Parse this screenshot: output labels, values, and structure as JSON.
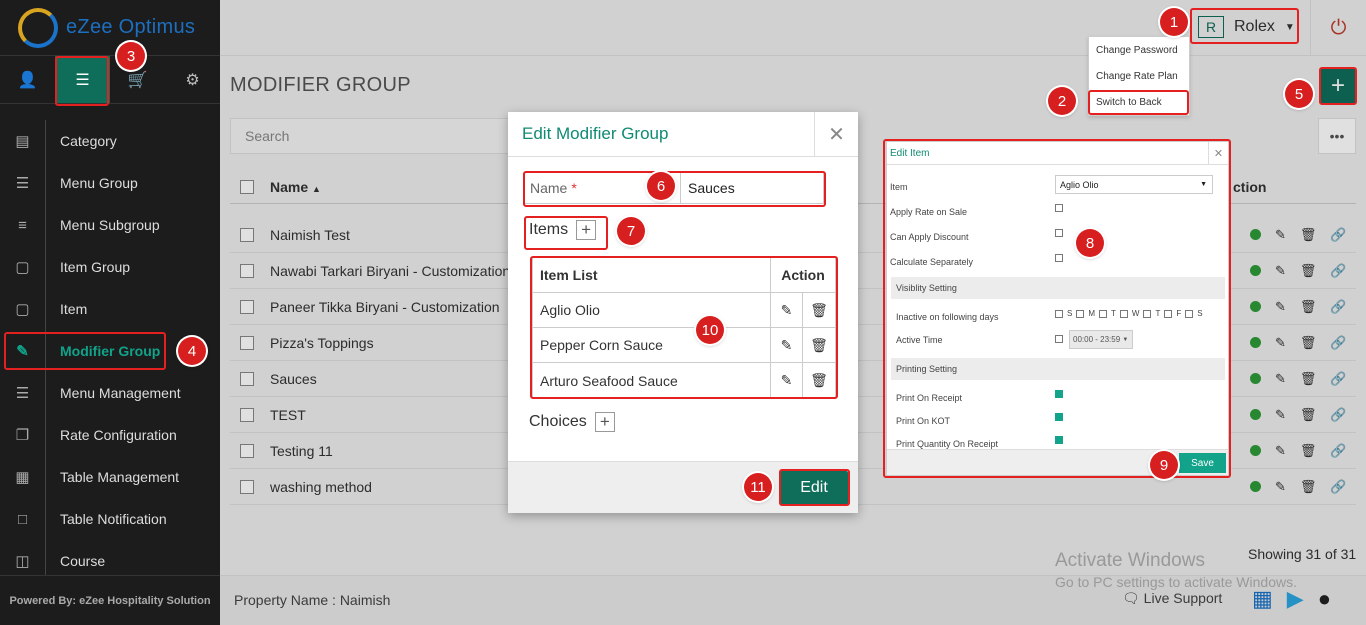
{
  "app": {
    "logo_text": "eZee Optimus",
    "powered_by": "Powered By: eZee Hospitality Solution"
  },
  "user": {
    "badge": "R",
    "name": "Rolex"
  },
  "user_menu": [
    "Change Password",
    "Change Rate Plan",
    "Switch to Back"
  ],
  "sidebar": {
    "items": [
      {
        "label": "Category",
        "icon": "category-icon"
      },
      {
        "label": "Menu Group",
        "icon": "list-icon"
      },
      {
        "label": "Menu Subgroup",
        "icon": "sublist-icon"
      },
      {
        "label": "Item Group",
        "icon": "box-icon"
      },
      {
        "label": "Item",
        "icon": "box-icon"
      },
      {
        "label": "Modifier Group",
        "icon": "edit-icon"
      },
      {
        "label": "Menu Management",
        "icon": "menu-icon"
      },
      {
        "label": "Rate Configuration",
        "icon": "rate-icon"
      },
      {
        "label": "Table Management",
        "icon": "grid-icon"
      },
      {
        "label": "Table Notification",
        "icon": "chat-icon"
      },
      {
        "label": "Course",
        "icon": "course-icon"
      }
    ]
  },
  "page": {
    "title": "MODIFIER GROUP",
    "search_placeholder": "Search",
    "col_name": "Name",
    "col_action": "ction",
    "showing": "Showing 31 of 31",
    "rows": [
      "Naimish Test",
      "Nawabi Tarkari Biryani - Customization",
      "Paneer Tikka Biryani - Customization",
      "Pizza's Toppings",
      "Sauces",
      "TEST",
      "Testing 11",
      "washing method"
    ]
  },
  "footer": {
    "property": "Property Name : Naimish",
    "live_support": "Live Support"
  },
  "windows_notice": {
    "line1": "Activate Windows",
    "line2": "Go to PC settings to activate Windows."
  },
  "modal": {
    "title": "Edit Modifier Group",
    "name_label": "Name",
    "name_required": "*",
    "name_value": "Sauces",
    "items_label": "Items",
    "item_list_header": "Item List",
    "action_header": "Action",
    "items": [
      "Aglio Olio",
      "Pepper Corn Sauce",
      "Arturo Seafood Sauce"
    ],
    "choices_label": "Choices",
    "edit_button": "Edit"
  },
  "edit_item": {
    "title": "Edit Item",
    "item_label": "Item",
    "item_value": "Aglio Olio",
    "apply_rate": "Apply Rate on Sale",
    "can_discount": "Can Apply Discount",
    "calc_separately": "Calculate Separately",
    "visibility_section": "Visiblity Setting",
    "inactive_days": "Inactive on following days",
    "days": [
      "S",
      "M",
      "T",
      "W",
      "T",
      "F",
      "S"
    ],
    "active_time": "Active Time",
    "time_value": "00:00 - 23:59",
    "printing_section": "Printing Setting",
    "print_receipt": "Print On Receipt",
    "print_kot": "Print On KOT",
    "print_qty": "Print Quantity On Receipt",
    "save_button": "Save"
  },
  "annotations": [
    "1",
    "2",
    "3",
    "4",
    "5",
    "6",
    "7",
    "8",
    "9",
    "10",
    "11"
  ],
  "colors": {
    "accent": "#0f6e5a",
    "annotation": "#d81f1f",
    "sidebar": "#1c1c1c"
  }
}
